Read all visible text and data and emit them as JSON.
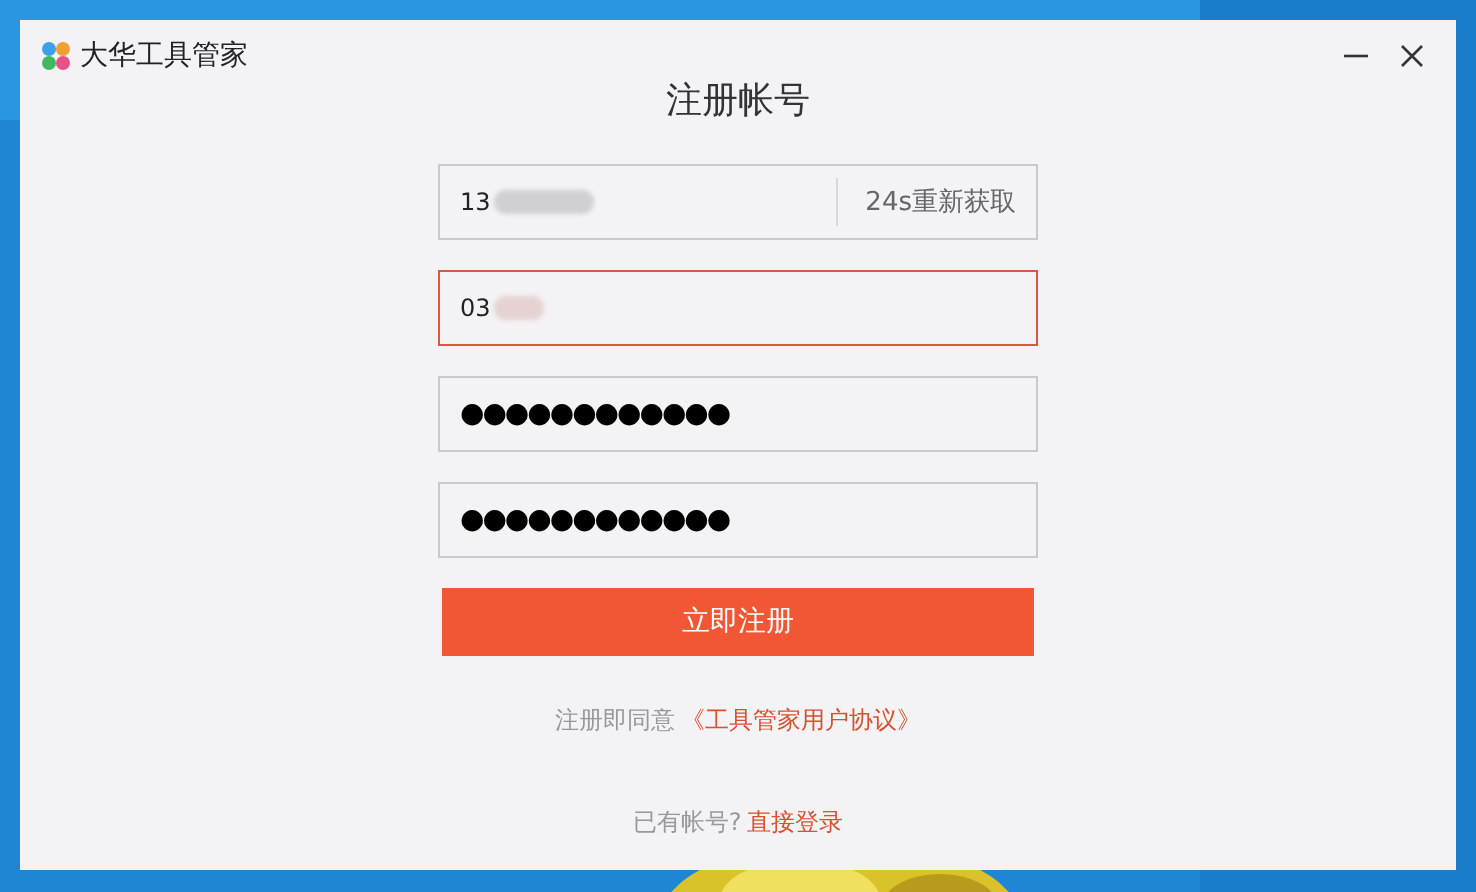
{
  "window": {
    "app_title": "大华工具管家",
    "heading": "注册帐号"
  },
  "fields": [
    {
      "kind": "phone",
      "value": "13",
      "redacted": true,
      "focused": false,
      "action": "24s重新获取"
    },
    {
      "kind": "code",
      "value": "03",
      "redacted": true,
      "focused": true
    },
    {
      "kind": "password",
      "value": "●●●●●●●●●●●●",
      "redacted": false,
      "focused": false
    },
    {
      "kind": "password",
      "value": "●●●●●●●●●●●●",
      "redacted": false,
      "focused": false
    }
  ],
  "submit_button": "立即注册",
  "agreement": {
    "text": "注册即同意",
    "link": "《工具管家用户协议》"
  },
  "login": {
    "text": "已有帐号?",
    "link": "直接登录"
  }
}
